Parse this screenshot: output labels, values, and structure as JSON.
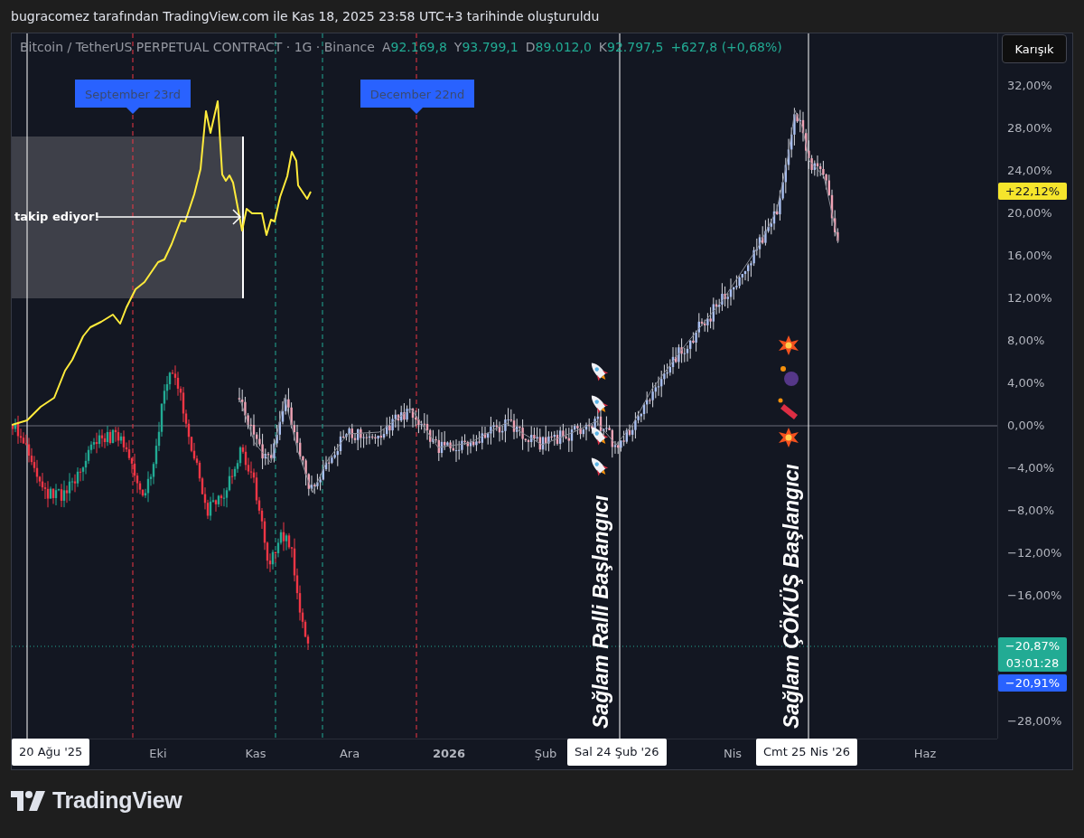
{
  "caption": "bugracomez tarafından TradingView.com ile Kas 18, 2025 23:58 UTC+3 tarihinde oluşturuldu",
  "legend": {
    "symbol": "Bitcoin / TetherUS PERPETUAL CONTRACT · 1G · Binance",
    "values": [
      {
        "label": "A",
        "value": "92.169,8"
      },
      {
        "label": "Y",
        "value": "93.799,1"
      },
      {
        "label": "D",
        "value": "89.012,0"
      },
      {
        "label": "K",
        "value": "92.797,5"
      }
    ],
    "change": "+627,8 (+0,68%)"
  },
  "scale_button": "Karışık",
  "callouts": [
    {
      "text": "September 23rd"
    },
    {
      "text": "December 22nd"
    }
  ],
  "annotation": "takip ediyor!",
  "vertical_notes": [
    "Sağlam Ralli Başlangıcı",
    "Sağlam ÇÖKÜŞ Başlangıcı"
  ],
  "price_axis": [
    "32,00%",
    "28,00%",
    "24,00%",
    "20,00%",
    "16,00%",
    "12,00%",
    "8,00%",
    "4,00%",
    "0,00%",
    "−4,00%",
    "−8,00%",
    "−12,00%",
    "−16,00%",
    "−28,00%"
  ],
  "price_badges": [
    {
      "kind": "price",
      "color": "#f5e52c",
      "text": "+22,12%"
    },
    {
      "kind": "countdown",
      "color": "#22ab94",
      "text": "−20,87%",
      "timer": "03:01:28"
    },
    {
      "kind": "price",
      "color": "#2962ff",
      "text": "−20,91%"
    }
  ],
  "time_axis": [
    {
      "kind": "marker",
      "text": "20 Ağu '25"
    },
    {
      "kind": "tick",
      "text": "Eki"
    },
    {
      "kind": "tick",
      "text": "Kas"
    },
    {
      "kind": "tick",
      "text": "Ara"
    },
    {
      "kind": "year",
      "text": "2026"
    },
    {
      "kind": "tick",
      "text": "Şub"
    },
    {
      "kind": "marker",
      "text": "Sal 24 Şub '26"
    },
    {
      "kind": "tick",
      "text": "Nis"
    },
    {
      "kind": "marker",
      "text": "Cmt 25 Nis '26"
    },
    {
      "kind": "tick",
      "text": "Haz"
    }
  ],
  "brand": "TradingView"
}
